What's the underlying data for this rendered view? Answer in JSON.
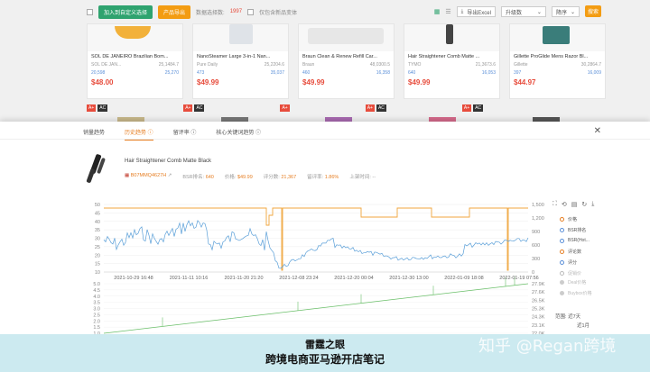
{
  "topbar": {
    "add_button": "加入到自定义选择",
    "import_button": "产品导出",
    "selected_label": "数据选择数:",
    "selected_count": "1997",
    "only_new_label": "仅包含新品变体",
    "csv_label": "导出Excel",
    "sort_label": "升级数",
    "period_label": "降序",
    "search_button": "搜索"
  },
  "cards": [
    {
      "title": "SOL DE JANEIRO Brazilian Bom...",
      "brand": "SOL DE JAN...",
      "bsr_a": "20,598",
      "val_a": "25,1484.7",
      "val_b": "25,270",
      "price": "$48.00"
    },
    {
      "title": "NanoSteamer Large 3-in-1 Nan...",
      "brand": "Pure Daily",
      "bsr_a": "473",
      "val_a": "25,2204.6",
      "val_b": "35,037",
      "price": "$49.99"
    },
    {
      "title": "Braun Clean & Renew Refill Car...",
      "brand": "Braun",
      "bsr_a": "460",
      "val_a": "48,0300.5",
      "val_b": "16,358",
      "price": "$49.99"
    },
    {
      "title": "Hair Straightener Comb Matte ...",
      "brand": "TYMO",
      "bsr_a": "640",
      "val_a": "21,3673.6",
      "val_b": "16,053",
      "price": "$49.99"
    },
    {
      "title": "Gillette ProGlide Mens Razor Bl...",
      "brand": "Gillette",
      "bsr_a": "397",
      "val_a": "30,2864.7",
      "val_b": "16,009",
      "price": "$44.97"
    }
  ],
  "tags": [
    "A+",
    "AC"
  ],
  "tabs": [
    {
      "label": "销量趋势"
    },
    {
      "label": "历史趋势 ⓘ"
    },
    {
      "label": "留评率 ⓘ"
    },
    {
      "label": "核心关键词趋势 ⓘ"
    }
  ],
  "product": {
    "title": "Hair Straightener Comb Matte Black",
    "asin": "B07MMQ4627H",
    "bsr_label": "BSR排名:",
    "bsr_value": "640",
    "price_label": "价格:",
    "price_value": "$49.99",
    "rating_label": "评分数:",
    "rating_value": "21,367",
    "review_rate_label": "留评率:",
    "review_rate_value": "1.86%",
    "launch_label": "上架时间:",
    "launch_value": "--"
  },
  "legend": [
    {
      "label": "价格",
      "color": "#e67e22",
      "on": true
    },
    {
      "label": "BSR排名",
      "color": "#5a8fd8",
      "on": true
    },
    {
      "label": "BSR(Hot...",
      "color": "#5a8fd8",
      "on": true
    },
    {
      "label": "评论数",
      "color": "#e67e22",
      "on": true
    },
    {
      "label": "评分",
      "color": "#e67e22",
      "on": true
    },
    {
      "label": "促销价",
      "color": "#bbb",
      "on": false
    }
  ],
  "legend2": [
    {
      "label": "Deal价格"
    },
    {
      "label": "Buybox价格"
    }
  ],
  "side2": {
    "label": "范围:",
    "opt1": "近7天",
    "opt2": "近1月",
    "opt3": "近一年",
    "opt4": "所有",
    "opt5": "近1年"
  },
  "chart_data": {
    "type": "line",
    "x_ticks": [
      "2021-10-29 16:48",
      "2021-11-11 10:16",
      "2021-11-20 21:20",
      "2021-12-08 23:24",
      "2021-12-20 00:04",
      "2021-12-30 13:00",
      "2022-01-09 18:08",
      "2022-01-19 07:56"
    ],
    "y_left_ticks": [
      "50",
      "45",
      "40",
      "35",
      "30",
      "25",
      "20",
      "15",
      "10"
    ],
    "y_right_ticks": [
      "1,500",
      "1,200",
      "900",
      "600",
      "300",
      "0"
    ],
    "series": [
      {
        "name": "价格",
        "color": "#f0a63c"
      },
      {
        "name": "BSR排名",
        "color": "#5a9fd8"
      }
    ],
    "lower_y_left_ticks": [
      "5.0",
      "4.5",
      "4.0",
      "3.5",
      "3.0",
      "2.5",
      "2.0",
      "1.5",
      "1.0"
    ],
    "lower_y_right_ticks": [
      "27.9K",
      "27.6K",
      "26.5K",
      "25.3K",
      "24.3K",
      "23.1K",
      "22.0K"
    ],
    "lower_series": [
      {
        "name": "评论数",
        "color": "#6abf69"
      }
    ]
  },
  "banner": {
    "line1": "雷霆之眼",
    "line2": "跨境电商亚马逊开店笔记",
    "watermark": "知乎 @Regan跨境"
  }
}
